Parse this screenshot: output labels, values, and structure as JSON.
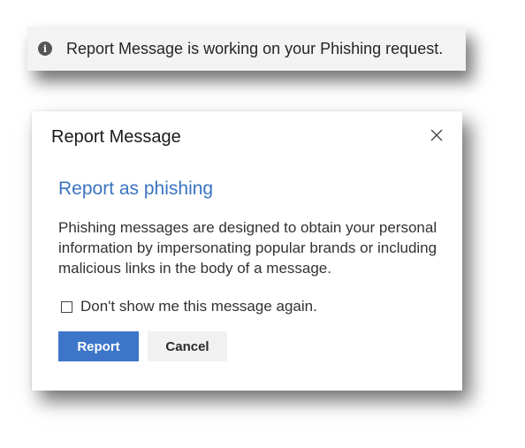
{
  "notification": {
    "icon": "info-icon",
    "icon_glyph": "i",
    "text": "Report Message is working on your Phishing request."
  },
  "dialog": {
    "title": "Report Message",
    "close_icon": "close-icon",
    "heading": "Report as phishing",
    "body": "Phishing messages are designed to obtain your personal information by impersonating popular brands or including malicious links in the body of a message.",
    "checkbox_label": "Don't show me this message again.",
    "checkbox_checked": false,
    "report_label": "Report",
    "cancel_label": "Cancel"
  },
  "colors": {
    "accent": "#3d76c9",
    "heading": "#3a73c2",
    "notification_bg": "#f3f3f3"
  }
}
